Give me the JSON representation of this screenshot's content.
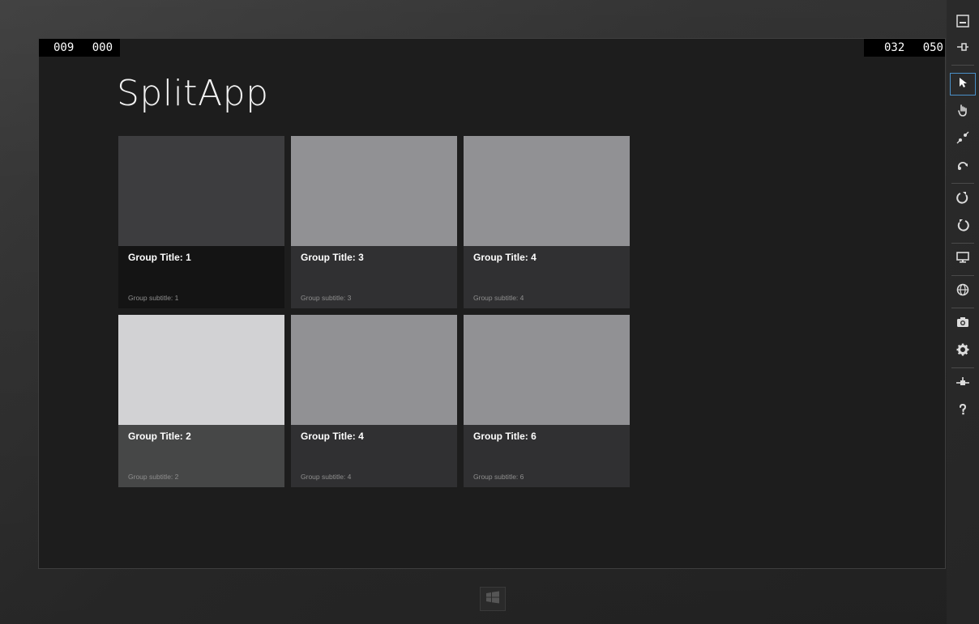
{
  "app": {
    "title": "SplitApp"
  },
  "status": {
    "left": [
      "009",
      "000"
    ],
    "right": [
      "032",
      "050"
    ]
  },
  "groups": [
    {
      "title": "Group Title: 1",
      "subtitle": "Group subtitle: 1",
      "image_color": "#3d3d3f",
      "caption_color": "#141414"
    },
    {
      "title": "Group Title: 3",
      "subtitle": "Group subtitle: 3",
      "image_color": "#919194",
      "caption_color": "#303032"
    },
    {
      "title": "Group Title: 4",
      "subtitle": "Group subtitle: 4",
      "image_color": "#919194",
      "caption_color": "#303032"
    },
    {
      "title": "Group Title: 2",
      "subtitle": "Group subtitle: 2",
      "image_color": "#d2d2d4",
      "caption_color": "#464747"
    },
    {
      "title": "Group Title: 4",
      "subtitle": "Group subtitle: 4",
      "image_color": "#919194",
      "caption_color": "#303032"
    },
    {
      "title": "Group Title: 6",
      "subtitle": "Group subtitle: 6",
      "image_color": "#919194",
      "caption_color": "#303032"
    }
  ],
  "toolbar": {
    "tools": [
      {
        "icon": "minimize-icon"
      },
      {
        "icon": "pin-icon"
      },
      {
        "icon": "mouse-mode-icon",
        "selected": true
      },
      {
        "icon": "touch-mode-icon"
      },
      {
        "icon": "pinch-zoom-icon"
      },
      {
        "icon": "rotation-touch-icon"
      },
      {
        "icon": "rotate-clockwise-icon"
      },
      {
        "icon": "rotate-counterclockwise-icon"
      },
      {
        "icon": "change-resolution-icon"
      },
      {
        "icon": "set-location-icon"
      },
      {
        "icon": "screenshot-icon"
      },
      {
        "icon": "settings-icon"
      },
      {
        "icon": "network-icon"
      },
      {
        "icon": "help-icon"
      }
    ]
  },
  "colors": {
    "accent": "#4a90c8",
    "screen_background": "#1d1d1d"
  }
}
